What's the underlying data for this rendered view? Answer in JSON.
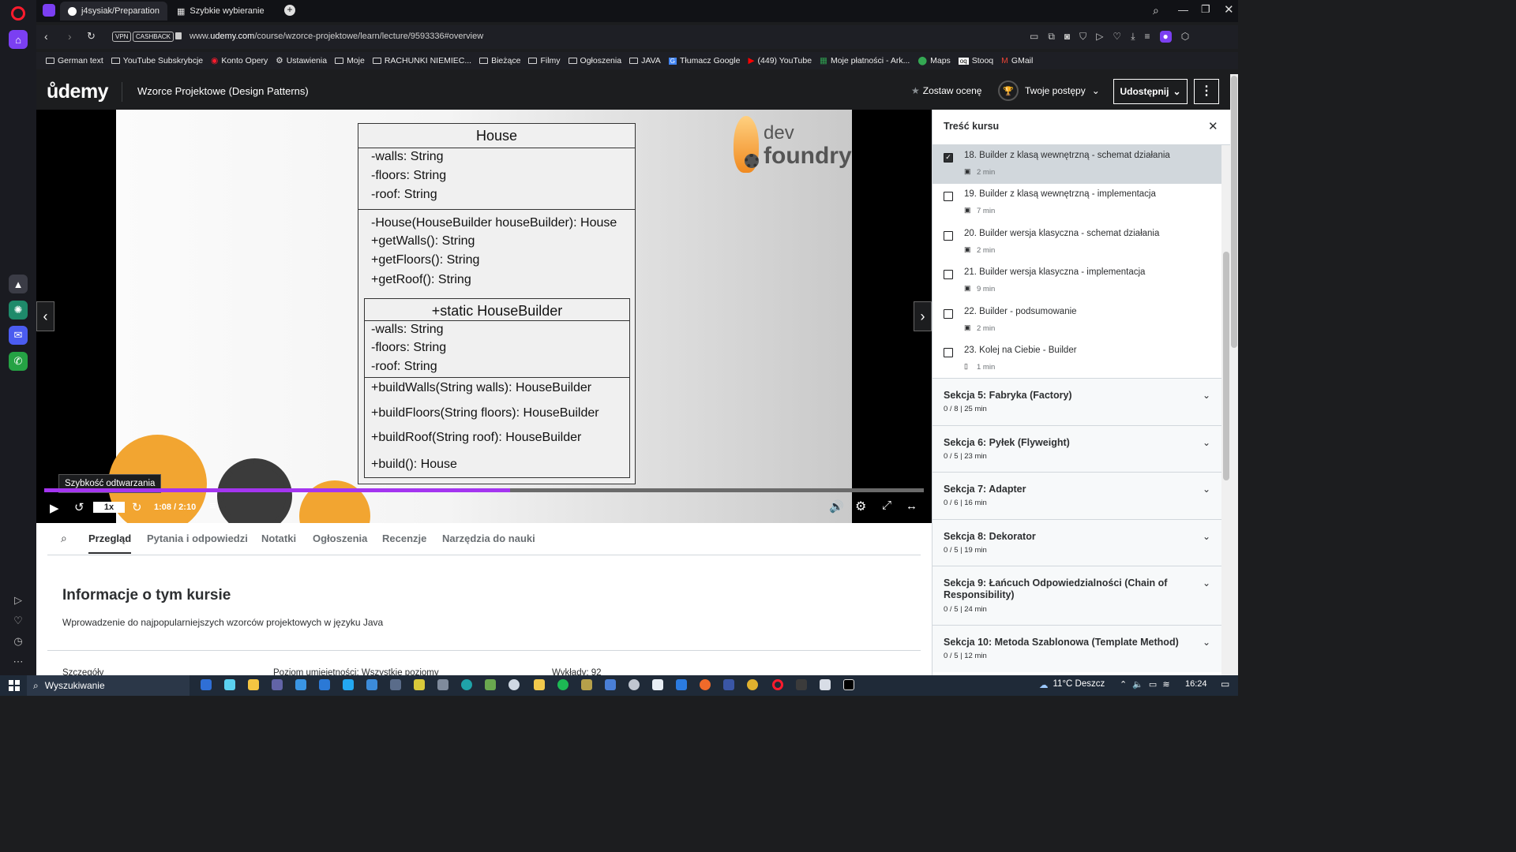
{
  "browser": {
    "tabs": [
      {
        "label": "j4sysiak/Preparation"
      },
      {
        "label": "Szybkie wybieranie"
      }
    ],
    "url_prefix": "www.",
    "url_domain": "udemy.com",
    "url_path": "/course/wzorce-projektowe/learn/lecture/9593336#overview",
    "vpn": "VPN",
    "cashback": "CASHBACK",
    "bookmarks": [
      "German text",
      "YouTube Subskrybcje",
      "Konto Opery",
      "Ustawienia",
      "Moje",
      "RACHUNKI NIEMIEC...",
      "Bieżące",
      "Filmy",
      "Ogłoszenia",
      "JAVA",
      "Tłumacz Google",
      "(449) YouTube",
      "Moje płatności - Ark...",
      "Maps",
      "Stooq",
      "GMail"
    ]
  },
  "header": {
    "logo": "ůdemy",
    "course_title": "Wzorce Projektowe (Design Patterns)",
    "rate_label": "Zostaw ocenę",
    "progress_label": "Twoje postępy",
    "share_label": "Udostępnij"
  },
  "slide": {
    "brand_top": "dev",
    "brand_bottom": "foundry",
    "house_title": "House",
    "house_fields": [
      "-walls: String",
      "-floors: String",
      "-roof: String"
    ],
    "house_methods": [
      "-House(HouseBuilder houseBuilder): House",
      "+getWalls(): String",
      "+getFloors(): String",
      "+getRoof(): String"
    ],
    "builder_title": "+static HouseBuilder",
    "builder_fields": [
      "-walls: String",
      "-floors: String",
      "-roof: String"
    ],
    "builder_methods": [
      "+buildWalls(String walls): HouseBuilder",
      "+buildFloors(String floors): HouseBuilder",
      "+buildRoof(String roof): HouseBuilder",
      "+build(): House"
    ]
  },
  "player": {
    "tooltip": "Szybkość odtwarzania",
    "speed": "1x",
    "time": "1:08 / 2:10",
    "progress_fraction": 0.53
  },
  "tabs": {
    "items": [
      "Przegląd",
      "Pytania i odpowiedzi",
      "Notatki",
      "Ogłoszenia",
      "Recenzje",
      "Narzędzia do nauki"
    ],
    "about_title": "Informacje o tym kursie",
    "about_text": "Wprowadzenie do najpopularniejszych wzorców projektowych w języku Java",
    "details_label": "Szczegóły",
    "level_label": "Poziom umiejętności: Wszystkie poziomy",
    "lectures_label": "Wykłady: 92"
  },
  "sidebar": {
    "title": "Treść kursu",
    "lectures": [
      {
        "title": "18. Builder z klasą wewnętrzną - schemat działania",
        "duration": "2 min",
        "checked": true
      },
      {
        "title": "19. Builder z klasą wewnętrzną - implementacja",
        "duration": "7 min",
        "checked": false
      },
      {
        "title": "20. Builder wersja klasyczna - schemat działania",
        "duration": "2 min",
        "checked": false
      },
      {
        "title": "21. Builder wersja klasyczna - implementacja",
        "duration": "9 min",
        "checked": false
      },
      {
        "title": "22. Builder - podsumowanie",
        "duration": "2 min",
        "checked": false
      },
      {
        "title": "23. Kolej na Ciebie - Builder",
        "duration": "1 min",
        "checked": false
      }
    ],
    "sections": [
      {
        "title": "Sekcja 5: Fabryka (Factory)",
        "meta": "0 / 8 | 25 min"
      },
      {
        "title": "Sekcja 6: Pyłek (Flyweight)",
        "meta": "0 / 5 | 23 min"
      },
      {
        "title": "Sekcja 7: Adapter",
        "meta": "0 / 6 | 16 min"
      },
      {
        "title": "Sekcja 8: Dekorator",
        "meta": "0 / 5 | 19 min"
      },
      {
        "title": "Sekcja 9: Łańcuch Odpowiedzialności (Chain of Responsibility)",
        "meta": "0 / 5 | 24 min"
      },
      {
        "title": "Sekcja 10: Metoda Szablonowa (Template Method)",
        "meta": "0 / 5 | 12 min"
      }
    ]
  },
  "taskbar": {
    "search": "Wyszukiwanie",
    "weather": "11°C  Deszcz",
    "clock": "16:24"
  },
  "colors": {
    "udemy_purple": "#a435f0",
    "opera_red": "#ff1b2d"
  }
}
